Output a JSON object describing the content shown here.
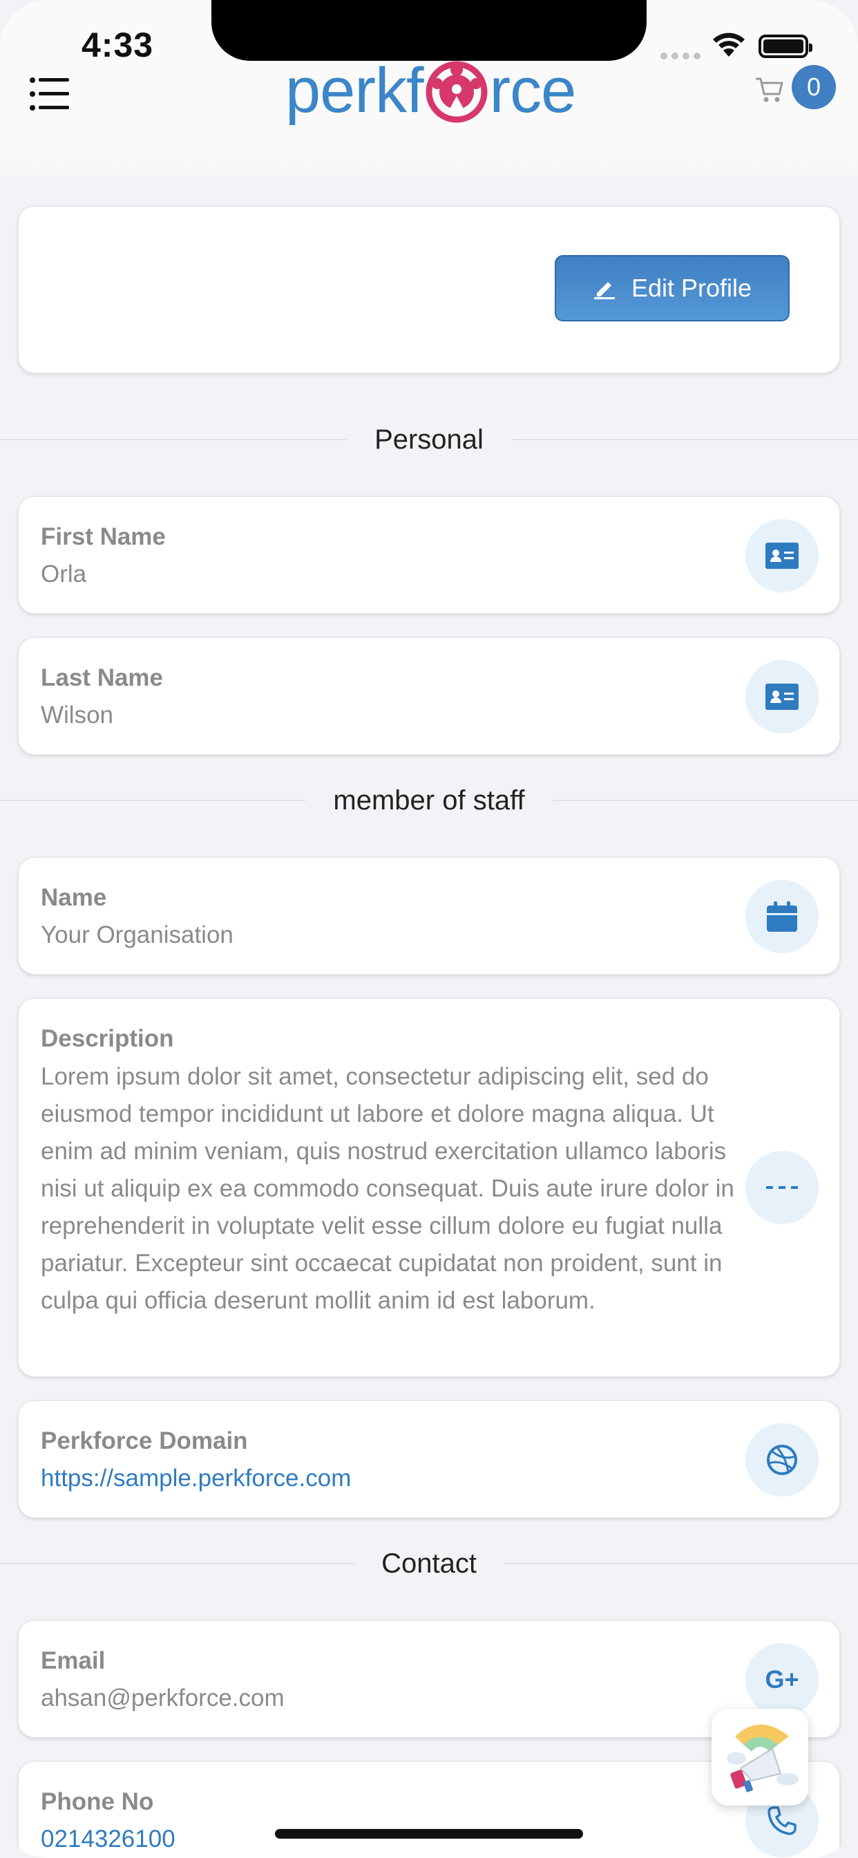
{
  "status_bar": {
    "time": "4:33"
  },
  "header": {
    "logo_left": "perkf",
    "logo_right": "rce",
    "cart_count": "0",
    "icons": {
      "menu": "menu-icon",
      "cart": "cart-icon"
    }
  },
  "profile": {
    "edit_label": "Edit Profile",
    "edit_icon": "pencil-icon"
  },
  "sections": {
    "personal": "Personal",
    "staff": "member of staff",
    "contact": "Contact"
  },
  "fields": {
    "first_name": {
      "label": "First Name",
      "value": "Orla",
      "icon": "id-card-icon"
    },
    "last_name": {
      "label": "Last Name",
      "value": "Wilson",
      "icon": "id-card-icon"
    },
    "org_name": {
      "label": "Name",
      "value": "Your Organisation",
      "icon": "calendar-icon"
    },
    "description": {
      "label": "Description",
      "value": "Lorem ipsum dolor sit amet, consectetur adipiscing elit, sed do eiusmod tempor incididunt ut labore et dolore magna aliqua. Ut enim ad minim veniam, quis nostrud exercitation ullamco laboris nisi ut aliquip ex ea commodo consequat. Duis aute irure dolor in reprehenderit in voluptate velit esse cillum dolore eu fugiat nulla pariatur. Excepteur sint occaecat cupidatat non proident, sunt in culpa qui officia deserunt mollit anim id est laborum.",
      "icon": "dashes-icon"
    },
    "domain": {
      "label": "Perkforce Domain",
      "value": "https://sample.perkforce.com",
      "icon": "dribbble-icon"
    },
    "email": {
      "label": "Email",
      "value": "ahsan@perkforce.com",
      "icon": "google-plus-icon"
    },
    "phone": {
      "label": "Phone No",
      "value": "0214326100",
      "icon": "phone-icon"
    }
  },
  "floating_button": {
    "icon": "megaphone-icon"
  },
  "colors": {
    "accent": "#2f7bc0",
    "brand_pink": "#d6386a",
    "icon_bg": "#e6f1fa"
  }
}
